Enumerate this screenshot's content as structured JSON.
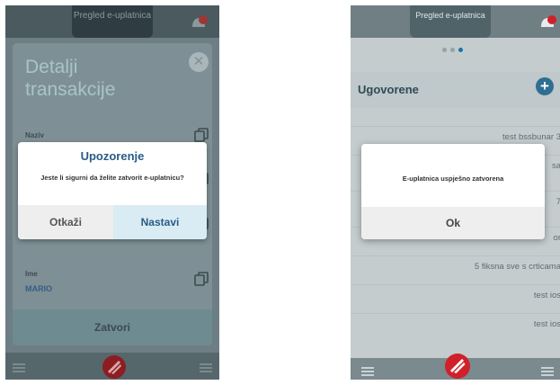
{
  "left_screen": {
    "header_title": "Pregled e-uplatnica",
    "modal_title": "Detalji transakcije",
    "fields": [
      {
        "label": "Naziv"
      },
      {
        "label": "Ime",
        "value": "MARIO"
      }
    ],
    "close_label": "Zatvori",
    "alert": {
      "title": "Upozorenje",
      "message": "Jeste li sigurni da želite zatvorit e-uplatnicu?",
      "cancel_label": "Otkaži",
      "continue_label": "Nastavi"
    }
  },
  "right_screen": {
    "header_title": "Pregled e-uplatnica",
    "section_title": "Ugovorene",
    "list_items": [
      "test bssbunar 3",
      "sa",
      "7",
      "or",
      "5 fiksna sve s crticama",
      "test ios",
      "test ios"
    ],
    "alert": {
      "message": "E-uplatnica uspješno zatvorena",
      "ok_label": "Ok"
    }
  },
  "colors": {
    "accent_blue": "#2a5b87",
    "logo_red": "#d0202a",
    "notification_red": "#e0262d"
  }
}
